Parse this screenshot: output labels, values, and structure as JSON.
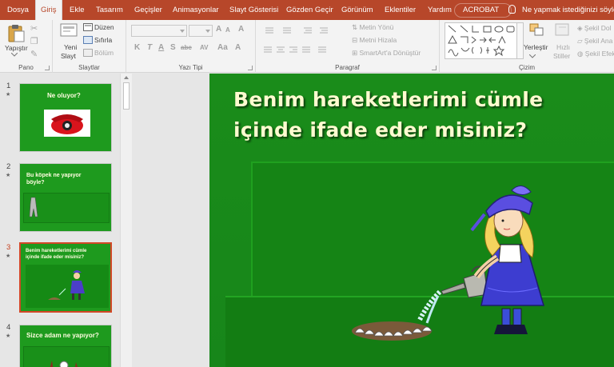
{
  "tabs": [
    {
      "label": "Dosya"
    },
    {
      "label": "Giriş"
    },
    {
      "label": "Ekle"
    },
    {
      "label": "Tasarım"
    },
    {
      "label": "Geçişler"
    },
    {
      "label": "Animasyonlar"
    },
    {
      "label": "Slayt Gösterisi"
    },
    {
      "label": "Gözden Geçir"
    },
    {
      "label": "Görünüm"
    },
    {
      "label": "Eklentiler"
    },
    {
      "label": "Yardım"
    },
    {
      "label": "ACROBAT"
    }
  ],
  "tell_me": "Ne yapmak istediğinizi söyley",
  "ribbon": {
    "clipboard": {
      "label": "Pano",
      "paste": "Yapıştır"
    },
    "slides": {
      "label": "Slaytlar",
      "new_slide_1": "Yeni",
      "new_slide_2": "Slayt",
      "layout": "Düzen",
      "reset": "Sıfırla",
      "section": "Bölüm"
    },
    "font": {
      "label": "Yazı Tipi",
      "bold": "K",
      "italic": "T",
      "underline": "A",
      "strike": "S",
      "shadow": "abc",
      "spacing": "AV",
      "case": "Aa",
      "grow": "A",
      "shrink": "A",
      "clear": "A",
      "color": "A"
    },
    "paragraph": {
      "label": "Paragraf",
      "text_direction": "Metin Yönü",
      "align_text": "Metni Hizala",
      "smartart": "SmartArt'a Dönüştür"
    },
    "drawing": {
      "label": "Çizim",
      "arrange_1": "Yerleştir",
      "quick_styles_1": "Hızlı",
      "quick_styles_2": "Stiller",
      "shape_fill": "Şekil Dol",
      "shape_outline": "Şekil Ana",
      "shape_effects": "Şekil Efek"
    }
  },
  "thumbnails": [
    {
      "number": "1",
      "star": "★",
      "title": "Ne oluyor?"
    },
    {
      "number": "2",
      "star": "★",
      "title_line1": "Bu köpek ne yapıyor",
      "title_line2": "böyle?"
    },
    {
      "number": "3",
      "star": "★",
      "title_line1": "Benim hareketlerimi cümle",
      "title_line2": "içinde ifade eder misiniz?"
    },
    {
      "number": "4",
      "star": "★",
      "title": "Sizce adam ne yapıyor?"
    }
  ],
  "slide": {
    "title_line1": "Benim hareketlerimi cümle",
    "title_line2": "içinde ifade eder misiniz?"
  },
  "colors": {
    "accent": "#b7472a",
    "slide_green": "#1a8c1a",
    "title_text": "#fffbd0"
  }
}
